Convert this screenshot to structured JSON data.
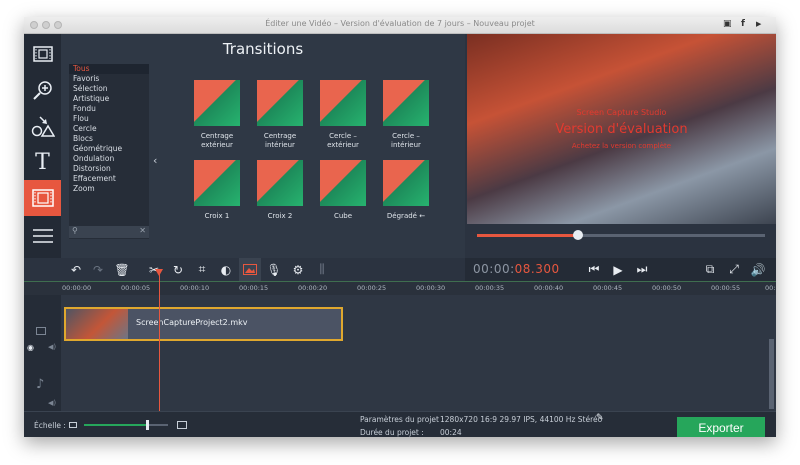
{
  "window": {
    "title": "Éditer une Vidéo – Version d'évaluation de 7 jours – Nouveau projet"
  },
  "panel": {
    "title": "Transitions",
    "categories": [
      "Tous",
      "Favoris",
      "Sélection",
      "Artistique",
      "Fondu",
      "Flou",
      "Cercle",
      "Blocs",
      "Géométrique",
      "Ondulation",
      "Distorsion",
      "Effacement",
      "Zoom"
    ],
    "selected_category": "Tous",
    "items": [
      {
        "label_line1": "Centrage",
        "label_line2": "extérieur"
      },
      {
        "label_line1": "Centrage",
        "label_line2": "intérieur"
      },
      {
        "label_line1": "Cercle –",
        "label_line2": "extérieur"
      },
      {
        "label_line1": "Cercle –",
        "label_line2": "intérieur"
      },
      {
        "label_line1": "Croix 1",
        "label_line2": ""
      },
      {
        "label_line1": "Croix 2",
        "label_line2": ""
      },
      {
        "label_line1": "Cube",
        "label_line2": ""
      },
      {
        "label_line1": "Dégradé ←",
        "label_line2": ""
      }
    ]
  },
  "preview": {
    "wm_line1": "Screen Capture Studio",
    "wm_line2": "Version d'évaluation",
    "wm_line3": "Achetez la version complète",
    "progress": 0.35
  },
  "timecode": {
    "gray": "00:00:",
    "red": "08.300"
  },
  "ruler": {
    "ticks": [
      "00:00:00",
      "00:00:05",
      "00:00:10",
      "00:00:15",
      "00:00:20",
      "00:00:25",
      "00:00:30",
      "00:00:35",
      "00:00:40",
      "00:00:45",
      "00:00:50",
      "00:00:55",
      "00:"
    ]
  },
  "clip": {
    "name": "ScreenCaptureProject2.mkv"
  },
  "status": {
    "scale_label": "Échelle :",
    "scale_level": 0.75,
    "params_label": "Paramètres du projet :",
    "params_value": "1280x720 16:9 29.97 IPS, 44100 Hz Stéréo",
    "duration_label": "Durée du projet :",
    "duration_value": "00:24",
    "export_label": "Exporter"
  },
  "colors": {
    "accent": "#e7573f",
    "export": "#26a65b",
    "clip_border": "#e0a82e"
  }
}
